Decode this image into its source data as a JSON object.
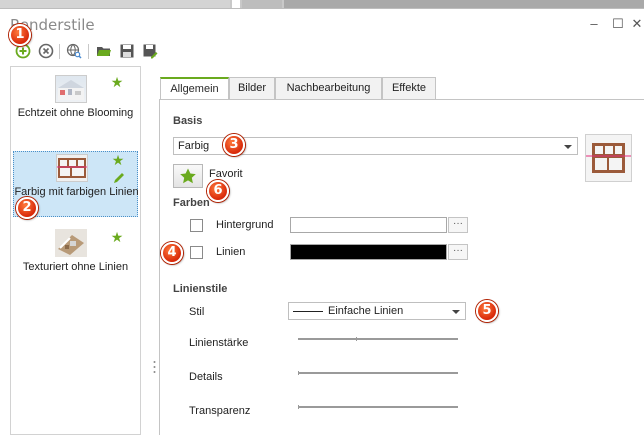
{
  "window": {
    "title": "Renderstile",
    "controls": {
      "minimize": "–",
      "maximize": "☐",
      "close": "✕"
    }
  },
  "toolbar": {
    "buttons": [
      {
        "name": "add",
        "icon": "add-circle-icon"
      },
      {
        "name": "remove",
        "icon": "remove-circle-icon"
      },
      {
        "name": "web-search",
        "icon": "globe-search-icon"
      },
      {
        "name": "open",
        "icon": "folder-open-icon"
      },
      {
        "name": "save",
        "icon": "save-icon"
      },
      {
        "name": "save-as",
        "icon": "save-as-icon"
      }
    ]
  },
  "styles": [
    {
      "label": "Echtzeit ohne Blooming",
      "favorite": true,
      "editable": false,
      "selected": false
    },
    {
      "label": "Farbig mit farbigen Linien",
      "favorite": true,
      "editable": true,
      "selected": true
    },
    {
      "label": "Texturiert ohne Linien",
      "favorite": true,
      "editable": false,
      "selected": false
    }
  ],
  "tabs": [
    {
      "label": "Allgemein",
      "active": true
    },
    {
      "label": "Bilder",
      "active": false
    },
    {
      "label": "Nachbearbeitung",
      "active": false
    },
    {
      "label": "Effekte",
      "active": false
    }
  ],
  "basis": {
    "section": "Basis",
    "value": "Farbig",
    "favorite_label": "Favorit"
  },
  "farben": {
    "section": "Farben",
    "rows": [
      {
        "label": "Hintergrund",
        "checked": false,
        "color": "#ffffff",
        "ellipsis": "···"
      },
      {
        "label": "Linien",
        "checked": false,
        "color": "#000000",
        "ellipsis": "···"
      }
    ]
  },
  "linienstile": {
    "section": "Linienstile",
    "stil_label": "Stil",
    "stil_value": "Einfache Linien",
    "sliders": [
      {
        "label": "Linienstärke"
      },
      {
        "label": "Details"
      },
      {
        "label": "Transparenz"
      }
    ]
  },
  "badges": [
    "1",
    "2",
    "3",
    "4",
    "5",
    "6"
  ],
  "colors": {
    "accent_green": "#6aaa1e",
    "badge_red": "#d8290a",
    "selection": "#cde6f7"
  }
}
